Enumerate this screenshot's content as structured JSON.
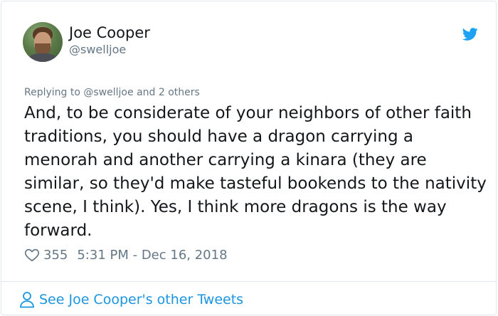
{
  "author": {
    "name": "Joe Cooper",
    "handle": "@swelljoe"
  },
  "reply": {
    "prefix": "Replying to",
    "mention": "@swelljoe",
    "suffix": "and 2 others"
  },
  "tweet": {
    "text": "And, to be considerate of your neighbors of other faith traditions, you should have a dragon carrying a menorah and another carrying a kinara (they are similar, so they'd make tasteful bookends to the nativity scene, I think). Yes, I think more dragons is the way forward.",
    "likes": "355",
    "timestamp": "5:31 PM - Dec 16, 2018"
  },
  "footer": {
    "link_label": "See Joe Cooper's other Tweets"
  },
  "icons": {
    "brand": "twitter-bird-icon",
    "like": "heart-icon",
    "profile": "person-icon"
  },
  "colors": {
    "brand_blue": "#1da1f2",
    "link_blue": "#1b95e0",
    "muted_gray": "#657786",
    "text": "#14171a",
    "border": "#e1e8ed"
  }
}
